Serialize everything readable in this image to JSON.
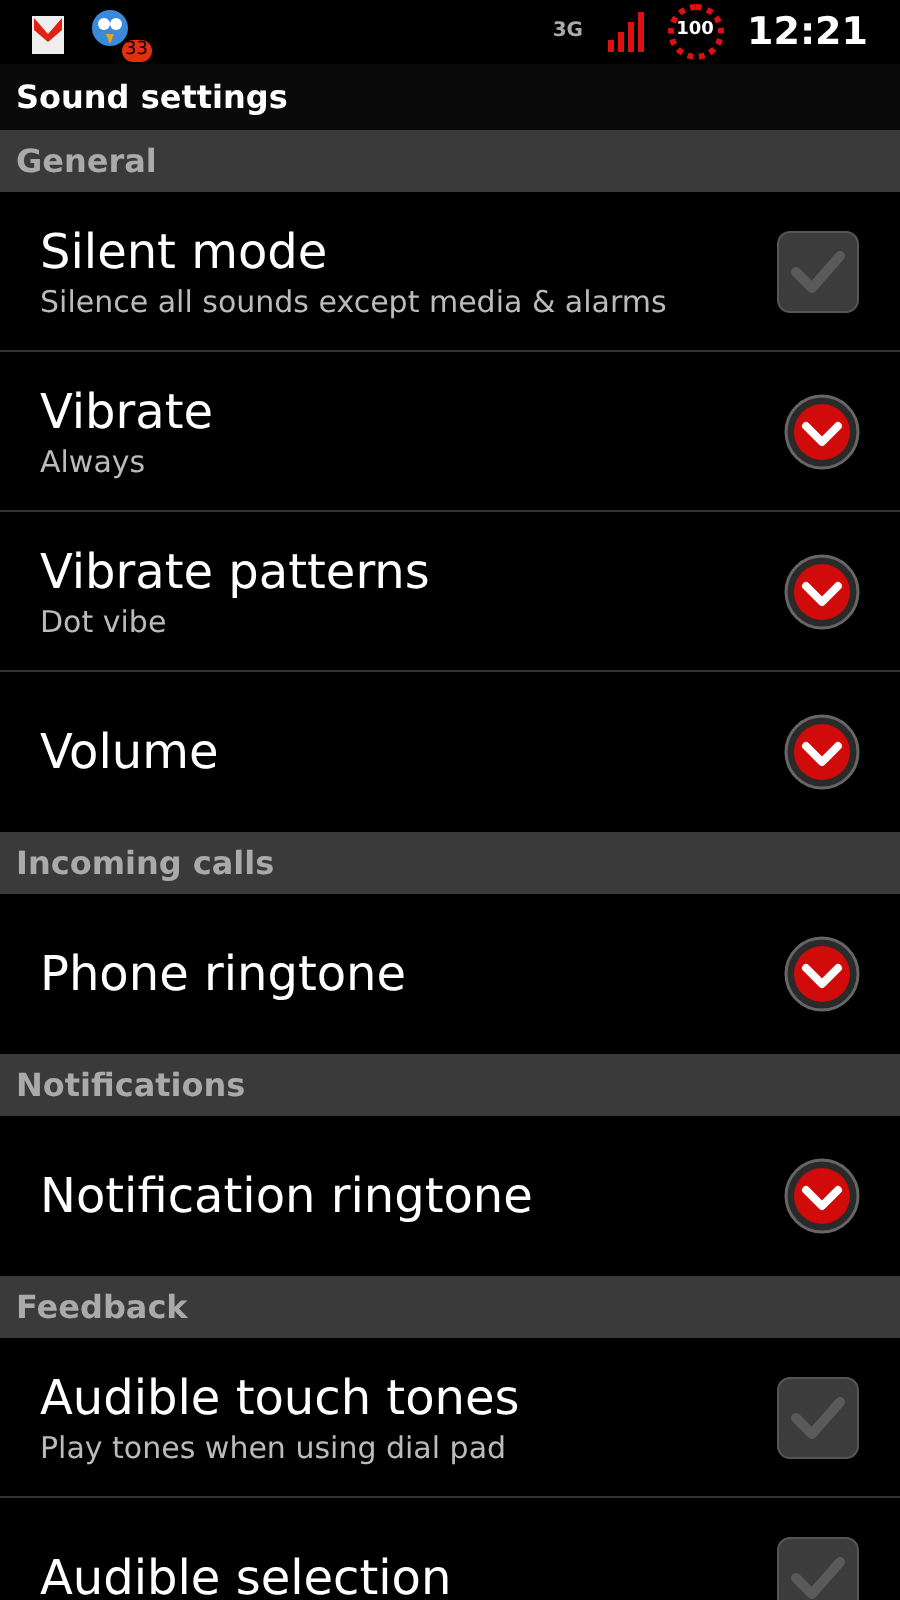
{
  "status_bar": {
    "badge": "33",
    "network": "3G",
    "battery": "100",
    "time": "12:21"
  },
  "title": "Sound settings",
  "sections": [
    {
      "header": "General",
      "items": [
        {
          "kind": "checkbox",
          "title": "Silent mode",
          "summary": "Silence all sounds except media & alarms",
          "checked": false
        },
        {
          "kind": "list",
          "title": "Vibrate",
          "summary": "Always"
        },
        {
          "kind": "list",
          "title": "Vibrate patterns",
          "summary": "Dot vibe"
        },
        {
          "kind": "list",
          "title": "Volume"
        }
      ]
    },
    {
      "header": "Incoming calls",
      "items": [
        {
          "kind": "list",
          "title": "Phone ringtone"
        }
      ]
    },
    {
      "header": "Notifications",
      "items": [
        {
          "kind": "list",
          "title": "Notification ringtone"
        }
      ]
    },
    {
      "header": "Feedback",
      "items": [
        {
          "kind": "checkbox",
          "title": "Audible touch tones",
          "summary": "Play tones when using dial pad",
          "checked": false
        },
        {
          "kind": "checkbox",
          "title": "Audible selection",
          "checked": false
        }
      ]
    }
  ]
}
